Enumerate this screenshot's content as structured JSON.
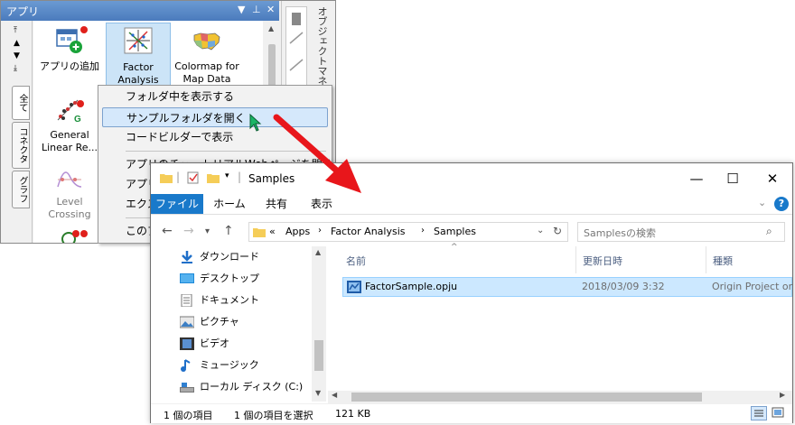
{
  "apps_panel": {
    "title": "アプリ",
    "pin_label": "▼ ᵖ ✕",
    "side_tabs": [
      "全て",
      "コネクタ",
      "グラフ"
    ],
    "right_dock_label": "オブジェクトマネ",
    "tiles": [
      {
        "label1": "アプリの追加",
        "label2": ""
      },
      {
        "label1": "Factor",
        "label2": "Analysis"
      },
      {
        "label1": "Colormap for",
        "label2": "Map Data"
      },
      {
        "label1": "General",
        "label2": "Linear Re..."
      },
      {
        "label1": "Level",
        "label2": "Crossing"
      }
    ]
  },
  "context_menu": {
    "items": [
      "フォルダ中を表示する",
      "サンプルフォルダを開く",
      "コードビルダーで表示",
      "アプリのチュートリアルWebページを開く",
      "アプリ",
      "エクス",
      "このア"
    ]
  },
  "explorer": {
    "title": "Samples",
    "title_sep": "| ",
    "ribbon_tabs": [
      "ファイル",
      "ホーム",
      "共有",
      "表示"
    ],
    "breadcrumb": [
      "«",
      "Apps",
      "Factor Analysis",
      "Samples"
    ],
    "search_placeholder": "Samplesの検索",
    "nav_items": [
      "ダウンロード",
      "デスクトップ",
      "ドキュメント",
      "ピクチャ",
      "ビデオ",
      "ミュージック",
      "ローカル ディスク (C:)"
    ],
    "columns": [
      "名前",
      "更新日時",
      "種類"
    ],
    "file": {
      "name": "FactorSample.opju",
      "date": "2018/03/09 3:32",
      "type": "Origin Project or"
    },
    "status": {
      "count": "1 個の項目",
      "selected": "1 個の項目を選択",
      "size": "121 KB"
    }
  },
  "colors": {
    "accent": "#1979ca",
    "selection": "#cce8ff",
    "arrow": "#e8161b",
    "titlebar": "#4b7bbd"
  }
}
